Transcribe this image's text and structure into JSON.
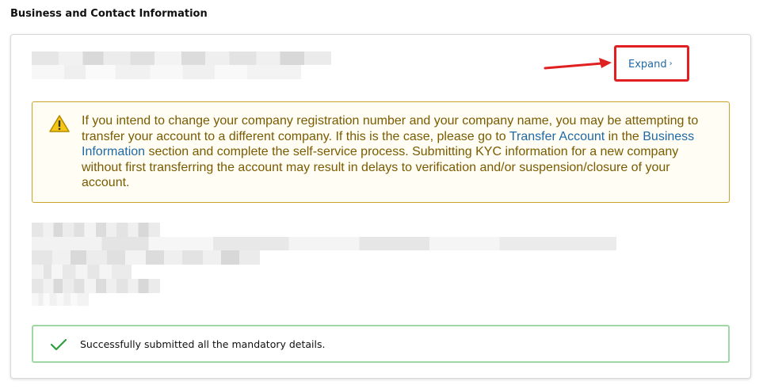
{
  "section": {
    "title": "Business and Contact Information"
  },
  "header": {
    "expand_label": "Expand",
    "expand_chevron": "›"
  },
  "annotation": {
    "highlight_color": "#e02020"
  },
  "warning": {
    "icon": "warning-triangle-icon",
    "text_1": "If you intend to change your company registration number and your company name, you may be attempting to transfer your account to a different company. If this is the case, please go to ",
    "link_1": "Transfer Account",
    "text_2": " in the ",
    "link_2": "Business Information",
    "text_3": " section and complete the self-service process. Submitting KYC information for a new company without first transferring the account may result in delays to verification and/or suspension/closure of your account.",
    "text_color": "#7a5b00",
    "link_color": "#1f6aa5",
    "border_color": "#c9a429"
  },
  "success": {
    "icon": "checkmark-icon",
    "message": "Successfully submitted all the mandatory details.",
    "accent_color": "#2e9e3e"
  }
}
